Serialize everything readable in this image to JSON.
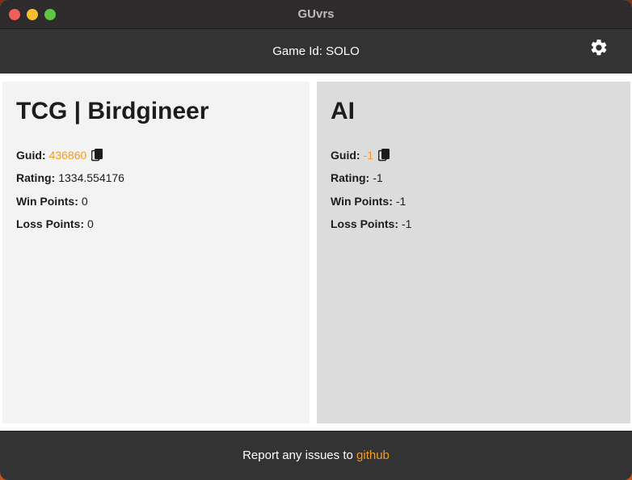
{
  "window": {
    "title": "GUvrs"
  },
  "header": {
    "game_id": "Game Id: SOLO",
    "settings_icon": "gear-icon"
  },
  "players": [
    {
      "name": "TCG | Birdgineer",
      "guid_label": "Guid:",
      "guid": "436860",
      "rating_label": "Rating:",
      "rating": "1334.554176",
      "win_label": "Win Points:",
      "win_points": "0",
      "loss_label": "Loss Points:",
      "loss_points": "0"
    },
    {
      "name": "AI",
      "guid_label": "Guid:",
      "guid": "-1",
      "rating_label": "Rating:",
      "rating": "-1",
      "win_label": "Win Points:",
      "win_points": "-1",
      "loss_label": "Loss Points:",
      "loss_points": "-1"
    }
  ],
  "footer": {
    "text": "Report any issues to",
    "link": "github"
  },
  "colors": {
    "accent": "#f39c1f",
    "bar": "#333333",
    "panel_left": "#f3f3f3",
    "panel_right": "#dcdcdc"
  }
}
